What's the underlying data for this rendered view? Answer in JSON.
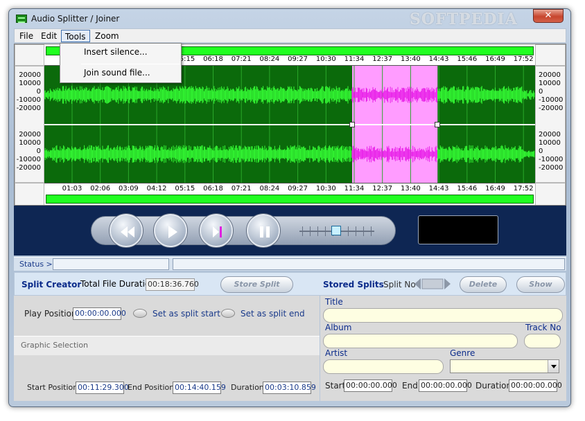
{
  "window": {
    "title": "Audio Splitter / Joiner",
    "watermark": "SOFTPEDIA",
    "close_symbol": "✕"
  },
  "menubar": {
    "file": "File",
    "edit": "Edit",
    "tools": "Tools",
    "zoom": "Zoom"
  },
  "tools_menu": {
    "items": [
      "Insert silence...",
      "Join sound file..."
    ]
  },
  "waveform": {
    "time_ticks": [
      "01:03",
      "02:06",
      "03:09",
      "04:12",
      "05:15",
      "06:18",
      "07:21",
      "08:24",
      "09:27",
      "10:30",
      "11:34",
      "12:37",
      "13:40",
      "14:43",
      "15:46",
      "16:49",
      "17:52"
    ],
    "amplitude_ticks": [
      "20000",
      "10000",
      "0",
      "-10000",
      "-20000"
    ],
    "selection": {
      "start": "11:29",
      "end": "14:40"
    },
    "colors": {
      "background": "#0b6a0b",
      "wave": "#35ff35",
      "selection_bg": "#ff9cff",
      "selection_wave": "#e81ce8",
      "grid": "#2aa82a"
    }
  },
  "status": {
    "label": "Status >"
  },
  "split_creator": {
    "title": "Split Creator",
    "total_duration_label": "Total File Duration",
    "total_duration": "00:18:36.760",
    "store_button": "Store Split",
    "stored_splits_title": "Stored Splits",
    "split_no_label": "Split No",
    "delete_button": "Delete",
    "show_button": "Show"
  },
  "left_panel": {
    "play_position_label": "Play Position",
    "play_position": "00:00:00.000",
    "set_start_label": "Set as split start",
    "set_end_label": "Set as split end",
    "graphic_selection_label": "Graphic Selection",
    "start_position_label": "Start Position",
    "start_position": "00:11:29.300",
    "end_position_label": "End Position",
    "end_position": "00:14:40.159",
    "duration_label": "Duration",
    "duration": "00:03:10.859"
  },
  "right_panel": {
    "title_label": "Title",
    "album_label": "Album",
    "track_no_label": "Track No",
    "artist_label": "Artist",
    "genre_label": "Genre",
    "start_label": "Start",
    "start_value": "00:00:00.000",
    "end_label": "End",
    "end_value": "00:00:00.000",
    "duration_label": "Duration",
    "duration_value": "00:00:00.000"
  }
}
